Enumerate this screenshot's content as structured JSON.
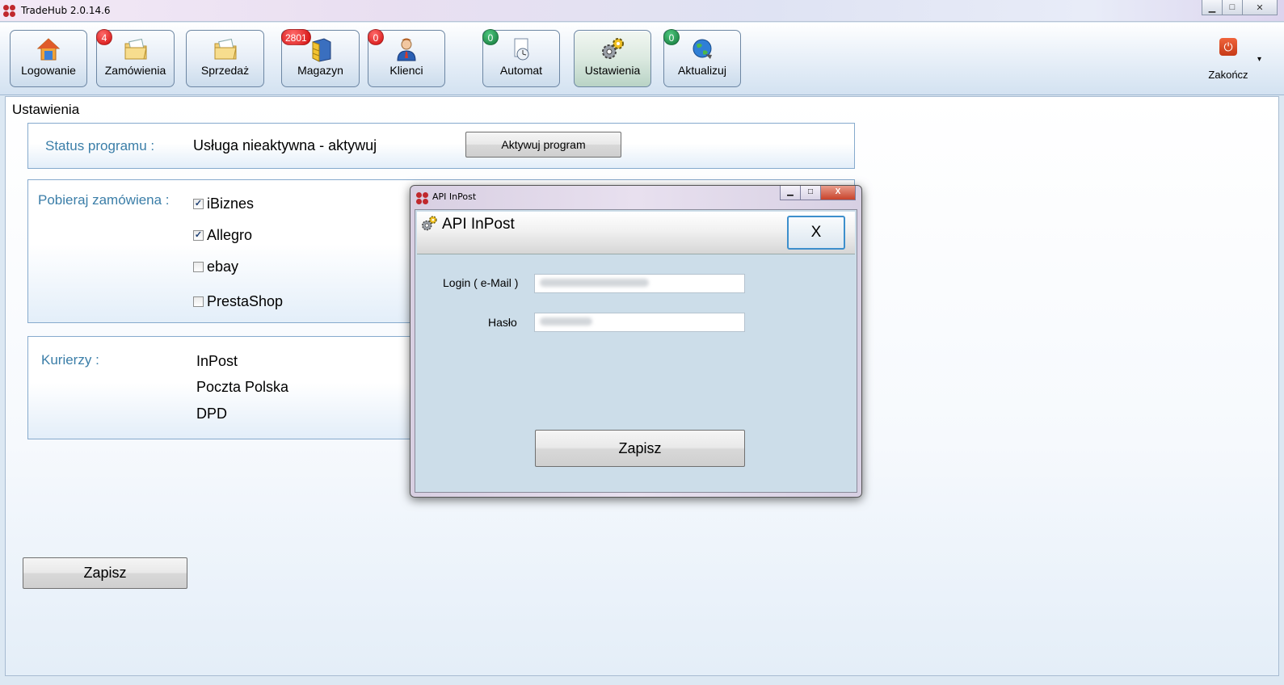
{
  "window": {
    "title": "TradeHub 2.0.14.6",
    "buttons": {
      "minimize": "▁",
      "maximize": "□",
      "close": "✕"
    }
  },
  "toolbar": {
    "buttons": [
      {
        "label": "Logowanie",
        "badge": "",
        "icon": "house-icon"
      },
      {
        "label": "Zamówienia",
        "badge": "4",
        "badge_color": "red",
        "icon": "folder-icon"
      },
      {
        "label": "Sprzedaż",
        "badge": "",
        "icon": "folder-icon"
      },
      {
        "label": "Magazyn",
        "badge": "2801",
        "badge_color": "red",
        "icon": "cabinet-icon"
      },
      {
        "label": "Klienci",
        "badge": "0",
        "badge_color": "red",
        "icon": "user-icon"
      },
      {
        "label": "Automat",
        "badge": "0",
        "badge_color": "green",
        "icon": "clock-document-icon"
      },
      {
        "label": "Ustawienia",
        "badge": "",
        "icon": "gears-icon"
      },
      {
        "label": "Aktualizuj",
        "badge": "0",
        "badge_color": "green",
        "icon": "globe-icon"
      }
    ],
    "quit_label": "Zakończ",
    "overflow": "▾"
  },
  "content": {
    "title": "Ustawienia",
    "status": {
      "label": "Status programu :",
      "value": "Usługa nieaktywna - aktywuj",
      "button": "Aktywuj program"
    },
    "orders": {
      "label": "Pobieraj zamówiena :",
      "options": [
        {
          "label": "iBiznes",
          "checked": true
        },
        {
          "label": "Allegro",
          "checked": true
        },
        {
          "label": "ebay",
          "checked": false
        },
        {
          "label": "PrestaShop",
          "checked": false
        }
      ]
    },
    "couriers": {
      "label": "Kurierzy :",
      "items": [
        "InPost",
        "Poczta Polska",
        "DPD"
      ]
    },
    "save_button": "Zapisz"
  },
  "dialog": {
    "window_title": "API InPost",
    "header_title": "API InPost",
    "close_label": "X",
    "login_label": "Login ( e-Mail )",
    "password_label": "Hasło",
    "save_button": "Zapisz",
    "window_buttons": {
      "minimize": "▁",
      "maximize": "□",
      "close": "X"
    }
  },
  "colors": {
    "label_blue": "#3b7ea8",
    "badge_red": "#d10c0c",
    "badge_green": "#157a3c",
    "focus_border": "#3d8fcc"
  }
}
